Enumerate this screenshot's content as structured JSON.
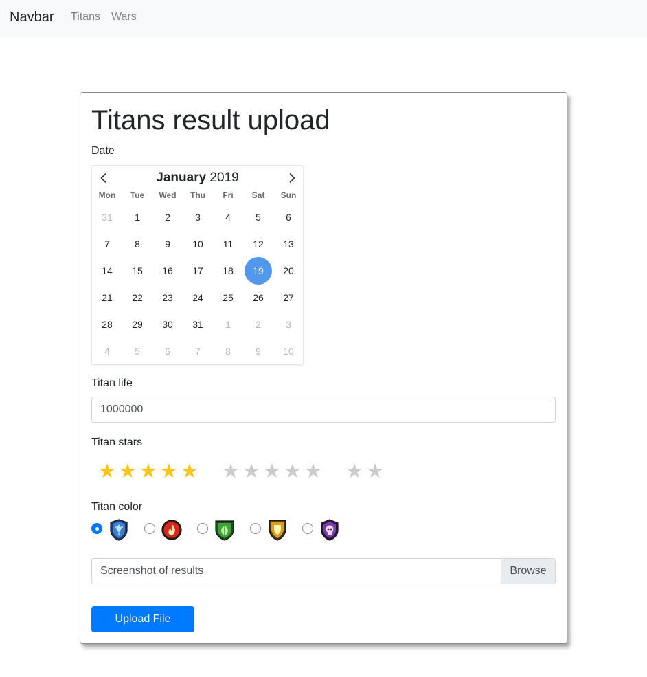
{
  "navbar": {
    "brand": "Navbar",
    "links": [
      "Titans",
      "Wars"
    ]
  },
  "form": {
    "title": "Titans result upload",
    "date_label": "Date",
    "calendar": {
      "month": "January",
      "year": "2019",
      "weekdays": [
        "Mon",
        "Tue",
        "Wed",
        "Thu",
        "Fri",
        "Sat",
        "Sun"
      ],
      "weeks": [
        [
          "31",
          "1",
          "2",
          "3",
          "4",
          "5",
          "6"
        ],
        [
          "7",
          "8",
          "9",
          "10",
          "11",
          "12",
          "13"
        ],
        [
          "14",
          "15",
          "16",
          "17",
          "18",
          "19",
          "20"
        ],
        [
          "21",
          "22",
          "23",
          "24",
          "25",
          "26",
          "27"
        ],
        [
          "28",
          "29",
          "30",
          "31",
          "1",
          "2",
          "3"
        ],
        [
          "4",
          "5",
          "6",
          "7",
          "8",
          "9",
          "10"
        ]
      ],
      "selected_day": "19",
      "accent_color": "#5197ee"
    },
    "life_label": "Titan life",
    "life_value": "1000000",
    "stars_label": "Titan stars",
    "stars_rating": 5,
    "stars_total": 12,
    "star_colors": {
      "filled": "#f9c512",
      "empty": "#cbcbcb"
    },
    "color_label": "Titan color",
    "color_options": [
      {
        "icon": "water-shield-icon",
        "color": "#3a7fd0",
        "checked": true
      },
      {
        "icon": "fire-emblem-icon",
        "color": "#d8281e",
        "checked": false
      },
      {
        "icon": "nature-shield-icon",
        "color": "#3fa33a",
        "checked": false
      },
      {
        "icon": "gold-shield-icon",
        "color": "#d8a21a",
        "checked": false
      },
      {
        "icon": "skull-shield-icon",
        "color": "#7a3fa6",
        "checked": false
      }
    ],
    "file_label": "Screenshot of results",
    "browse_label": "Browse",
    "upload_label": "Upload File",
    "primary_color": "#007bff"
  }
}
